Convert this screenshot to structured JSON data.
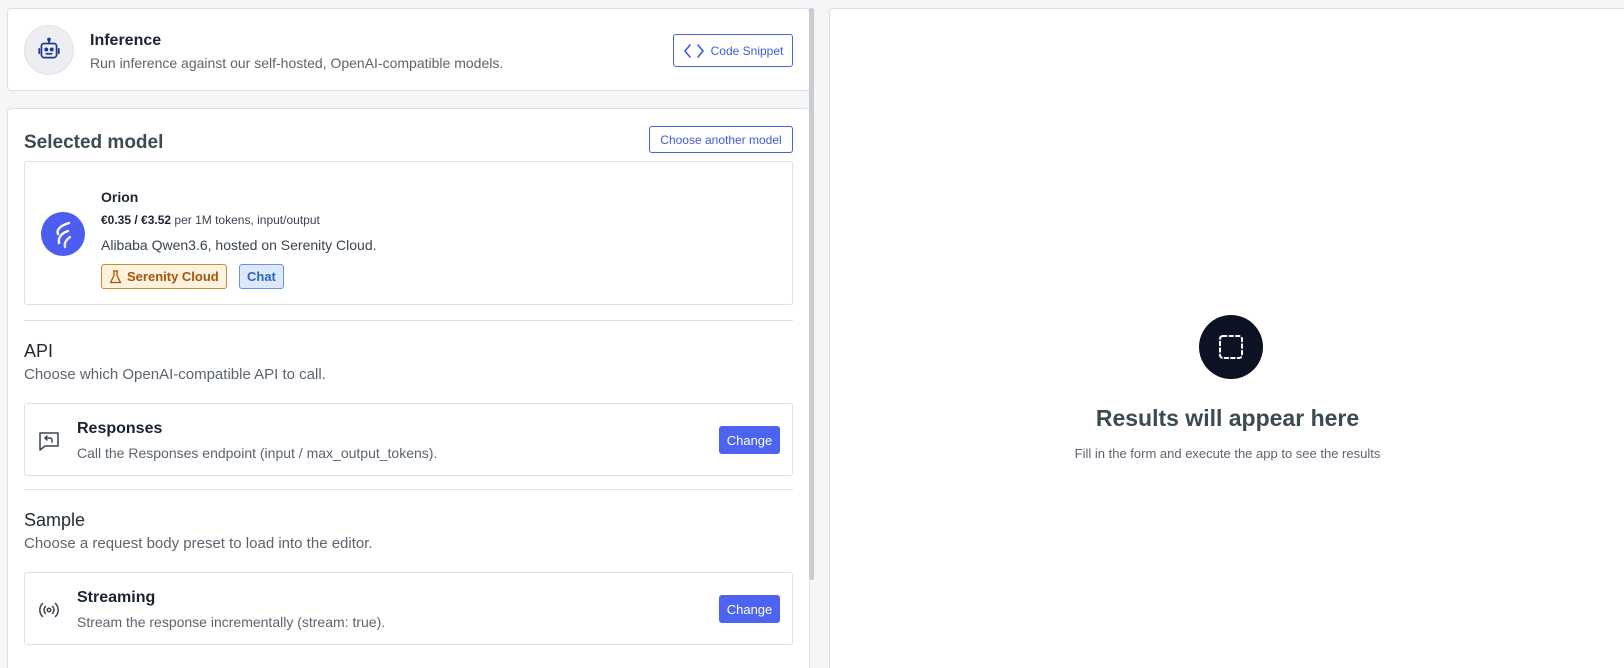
{
  "header": {
    "title": "Inference",
    "subtitle": "Run inference against our self-hosted, OpenAI-compatible models.",
    "code_snippet_label": "Code Snippet",
    "avatar_icon": "robot-icon"
  },
  "selected_model": {
    "section_title": "Selected model",
    "choose_label": "Choose another model",
    "model": {
      "name": "Orion",
      "price": "€0.35 / €3.52",
      "price_unit": "per 1M tokens, input/output",
      "description": "Alibaba Qwen3.6, hosted on Serenity Cloud.",
      "badges": [
        "Serenity Cloud",
        "Chat"
      ],
      "logo_icon": "serenity-logo-icon"
    }
  },
  "api": {
    "title": "API",
    "subtitle": "Choose which OpenAI-compatible API to call.",
    "option": {
      "title": "Responses",
      "description": "Call the Responses endpoint (input / max_output_tokens).",
      "button": "Change",
      "icon": "message-reply-icon"
    }
  },
  "sample": {
    "title": "Sample",
    "subtitle": "Choose a request body preset to load into the editor.",
    "option": {
      "title": "Streaming",
      "description": "Stream the response incrementally (stream: true).",
      "button": "Change",
      "icon": "broadcast-icon"
    }
  },
  "results": {
    "title": "Results will appear here",
    "subtitle": "Fill in the form and execute the app to see the results",
    "icon": "dashed-square-icon"
  },
  "colors": {
    "accent": "#4d63f2",
    "badge_cloud_bg": "#fff1dc",
    "badge_chat_bg": "#dce9fb",
    "result_icon_bg": "#0d1124"
  }
}
